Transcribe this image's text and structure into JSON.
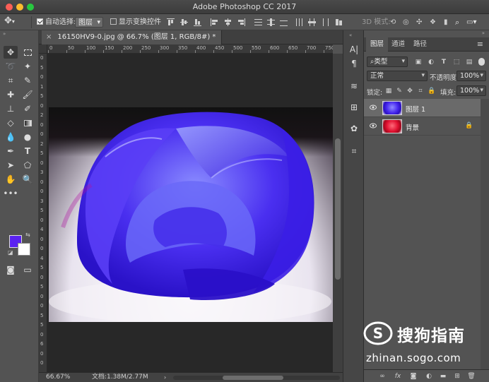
{
  "window": {
    "title": "Adobe Photoshop CC 2017"
  },
  "options_bar": {
    "auto_select_label": "自动选择:",
    "auto_select_value": "图层",
    "show_transform_label": "显示变换控件",
    "mode_3d_label": "3D 模式:"
  },
  "document": {
    "tab_title": "16150HV9-0.jpg @ 66.7% (图层 1, RGB/8#) *",
    "ruler_h": [
      "0",
      "50",
      "100",
      "150",
      "200",
      "250",
      "300",
      "350",
      "400",
      "450",
      "500",
      "550",
      "600",
      "650",
      "700",
      "750"
    ],
    "ruler_v": [
      "0",
      "5",
      "0",
      "1",
      "5",
      "0",
      "2",
      "0",
      "0",
      "2",
      "5",
      "0",
      "3",
      "0",
      "0",
      "3",
      "5",
      "0",
      "4",
      "0",
      "0",
      "4",
      "5",
      "0",
      "5",
      "0",
      "0",
      "5",
      "5",
      "0",
      "6",
      "0",
      "0"
    ]
  },
  "status": {
    "zoom": "66.67%",
    "doc_size": "文档:1.38M/2.77M"
  },
  "colors": {
    "foreground": "#5a22f0",
    "background": "#ffffff",
    "accent_title_red": "#fc5f57",
    "accent_title_yellow": "#fdbc2e",
    "accent_title_green": "#28c840"
  },
  "layers_panel": {
    "tabs": [
      "图层",
      "通道",
      "路径"
    ],
    "filter_kind": "类型",
    "blend_mode": "正常",
    "opacity_label": "不透明度:",
    "opacity_value": "100%",
    "lock_label": "锁定:",
    "fill_label": "填充:",
    "fill_value": "100%",
    "layers": [
      {
        "name": "图层 1",
        "selected": true,
        "locked": false
      },
      {
        "name": "背景",
        "selected": false,
        "locked": true
      }
    ]
  },
  "watermark": {
    "brand": "搜狗指南",
    "url": "zhinan.sogo.com"
  }
}
